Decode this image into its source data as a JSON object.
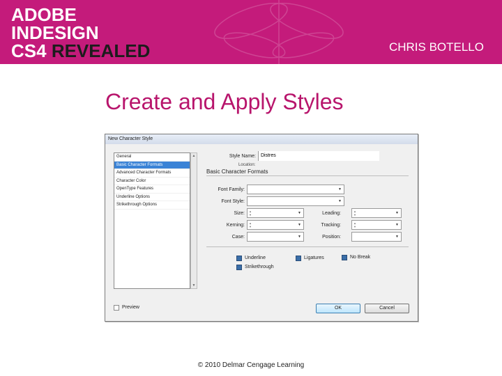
{
  "banner": {
    "line1": "ADOBE",
    "line2": "INDESIGN",
    "line3_a": "CS4 ",
    "line3_b": "REVEALED",
    "author": "CHRIS BOTELLO",
    "color": "#c41b7b"
  },
  "slide_title": "Create and Apply Styles",
  "dialog": {
    "title": "New Character Style",
    "left_items": [
      {
        "label": "General",
        "selected": false
      },
      {
        "label": "Basic Character Formats",
        "selected": true
      },
      {
        "label": "Advanced Character Formats",
        "selected": false
      },
      {
        "label": "Character Color",
        "selected": false
      },
      {
        "label": "OpenType Features",
        "selected": false
      },
      {
        "label": "Underline Options",
        "selected": false
      },
      {
        "label": "Strikethrough Options",
        "selected": false
      }
    ],
    "style_name_label": "Style Name:",
    "style_name_value": "Distres",
    "location_label": "Location:",
    "section_title": "Basic Character Formats",
    "labels": {
      "font_family": "Font Family:",
      "font_style": "Font Style:",
      "size": "Size:",
      "leading": "Leading:",
      "kerning": "Kerning:",
      "tracking": "Tracking:",
      "case": "Case:",
      "position": "Position:"
    },
    "checkboxes": {
      "underline": "Underline",
      "ligatures": "Ligatures",
      "no_break": "No Break",
      "strikethrough": "Strikethrough"
    },
    "preview": "Preview",
    "ok": "OK",
    "cancel": "Cancel"
  },
  "footer": "© 2010 Delmar Cengage Learning"
}
